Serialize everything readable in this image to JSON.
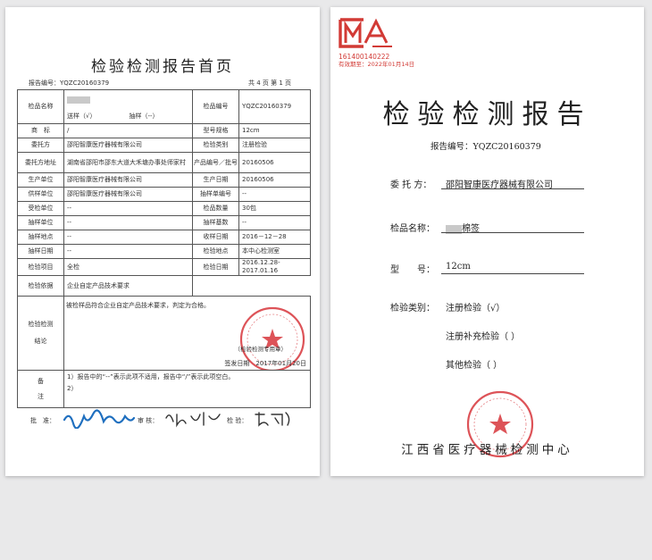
{
  "left_page": {
    "title": "检验检测报告首页",
    "report_no_label": "报告编号：",
    "report_no": "YQZC20160379",
    "page_info": "共 4 页 第 1 页",
    "rows": {
      "sample_name_label": "检品名称",
      "sample_code_label": "检品编号",
      "sample_code": "YQZC20160379",
      "send_option": "送样（√）",
      "sampling_option": "抽样（--）",
      "trademark_label": "商　标",
      "trademark": "/",
      "spec_label": "型号规格",
      "spec": "12cm",
      "client_label": "委托方",
      "client": "邵阳智康医疗器械有限公司",
      "test_type_label": "检验类别",
      "test_type": "注册检验",
      "client_addr_label": "委托方地址",
      "client_addr": "湖南省邵阳市邵东大道大禾塘办事处师家村",
      "product_no_label": "产品编号／批号",
      "product_no": "20160506",
      "producer_label": "生产单位",
      "producer": "邵阳智康医疗器械有限公司",
      "prod_date_label": "生产日期",
      "prod_date": "20160506",
      "supplier_label": "供样单位",
      "supplier": "邵阳智康医疗器械有限公司",
      "sampling_no_label": "抽样单编号",
      "sampling_no": "--",
      "inspected_unit_label": "受检单位",
      "inspected_unit": "--",
      "sample_qty_label": "检品数量",
      "sample_qty": "30包",
      "sampler_label": "抽样单位",
      "sampler": "--",
      "sample_base_label": "抽样基数",
      "sample_base": "--",
      "sampling_place_label": "抽样地点",
      "sampling_place": "--",
      "receive_date_label": "收样日期",
      "receive_date": "2016－12－28",
      "sampling_date_label": "抽样日期",
      "sampling_date": "--",
      "test_place_label": "检验地点",
      "test_place": "本中心检测室",
      "test_item_label": "检验项目",
      "test_item": "全检",
      "test_date_label": "检验日期",
      "test_date": "2016.12.28-2017.01.16",
      "basis_label": "检验依据",
      "basis": "企业自定产品技术要求",
      "conclusion_label_a": "检验检测",
      "conclusion_label_b": "结论",
      "conclusion": "被检样品符合企业自定产品技术要求，判定为合格。",
      "seal_note": "（检验检测专用章）",
      "issue_date": "签发日期　2017年01月20日",
      "remark_label_a": "备",
      "remark_label_b": "注",
      "note1": "1）报告中的“--”表示此项不适用，报告中“/”表示此项空白。",
      "note2": "2）"
    },
    "signatures": {
      "approve_label": "批　准：",
      "review_label": "审 核：",
      "test_label": "检 验："
    }
  },
  "right_page": {
    "cma_logo": "CMA",
    "cma_no": "161400140222",
    "cma_valid": "有效期至：2022年01月14日",
    "title": "检验检测报告",
    "report_no_label": "报告编号：",
    "report_no": "YQZC20160379",
    "client_label": "委 托 方：",
    "client": "邵阳智康医疗器械有限公司",
    "sample_label": "检品名称：",
    "sample_suffix": "棉签",
    "model_label": "型　　号：",
    "model": "12cm",
    "type_label": "检验类别：",
    "type_reg": "注册检验（√）",
    "type_suppl": "注册补充检验（ ）",
    "type_other": "其他检验（ ）",
    "footer": "江西省医疗器械检测中心"
  },
  "colors": {
    "seal_red": "#d7353b",
    "ink_blue": "#1f6fbf",
    "ink_black": "#222222"
  }
}
